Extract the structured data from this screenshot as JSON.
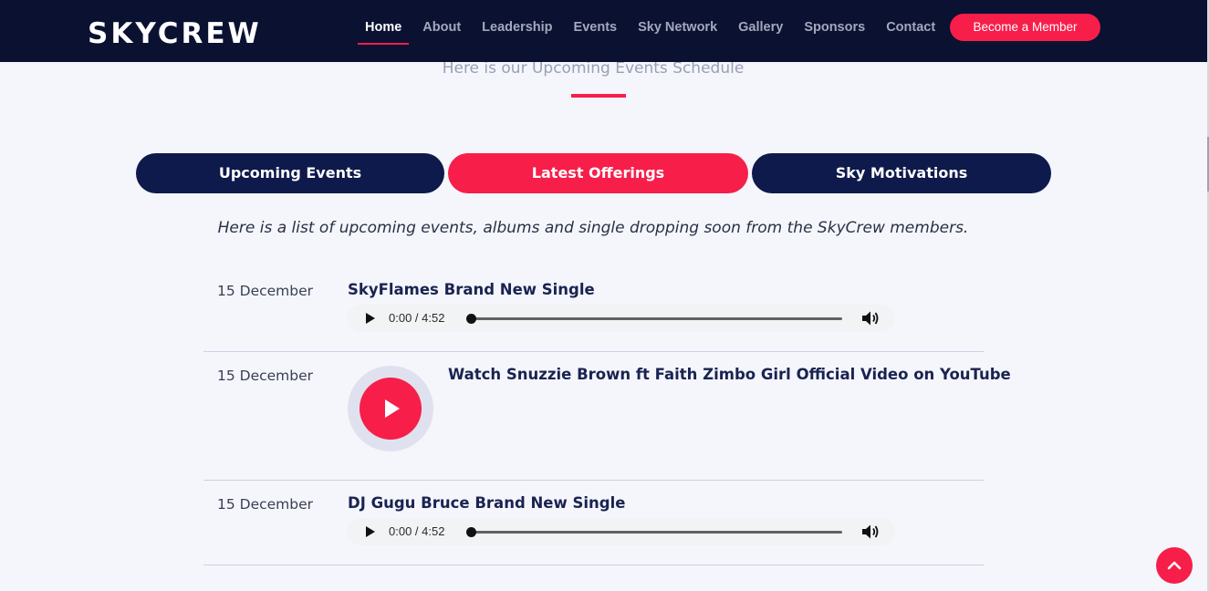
{
  "brand": {
    "logo": "SKYCREW",
    "accent_color": "#f71e4a",
    "navy_color": "#0e1a4b"
  },
  "nav": {
    "items": [
      {
        "label": "Home",
        "active": true
      },
      {
        "label": "About"
      },
      {
        "label": "Leadership"
      },
      {
        "label": "Events"
      },
      {
        "label": "Sky Network"
      },
      {
        "label": "Gallery"
      },
      {
        "label": "Sponsors"
      },
      {
        "label": "Contact"
      }
    ],
    "cta": "Become a Member"
  },
  "section": {
    "subheading": "Here is our Upcoming Events Schedule"
  },
  "tabs": [
    {
      "label": "Upcoming Events",
      "active": false
    },
    {
      "label": "Latest Offerings",
      "active": true
    },
    {
      "label": "Sky Motivations",
      "active": false
    }
  ],
  "intro": "Here is a list of upcoming events, albums and single dropping soon from the SkyCrew members.",
  "events": [
    {
      "date": "15 December",
      "title": "SkyFlames Brand New Single",
      "media": "audio",
      "time": "0:00 / 4:52",
      "progress": 0
    },
    {
      "date": "15 December",
      "title": "Watch Snuzzie Brown ft Faith Zimbo Girl Official Video on YouTube",
      "media": "video"
    },
    {
      "date": "15 December",
      "title": "DJ Gugu Bruce Brand New Single",
      "media": "audio",
      "time": "0:00 / 4:52",
      "progress": 0
    }
  ],
  "icons": {
    "audio_play": "play-icon",
    "volume": "volume-icon",
    "video_play": "video-play-icon",
    "scroll_top": "chevron-up-icon"
  }
}
